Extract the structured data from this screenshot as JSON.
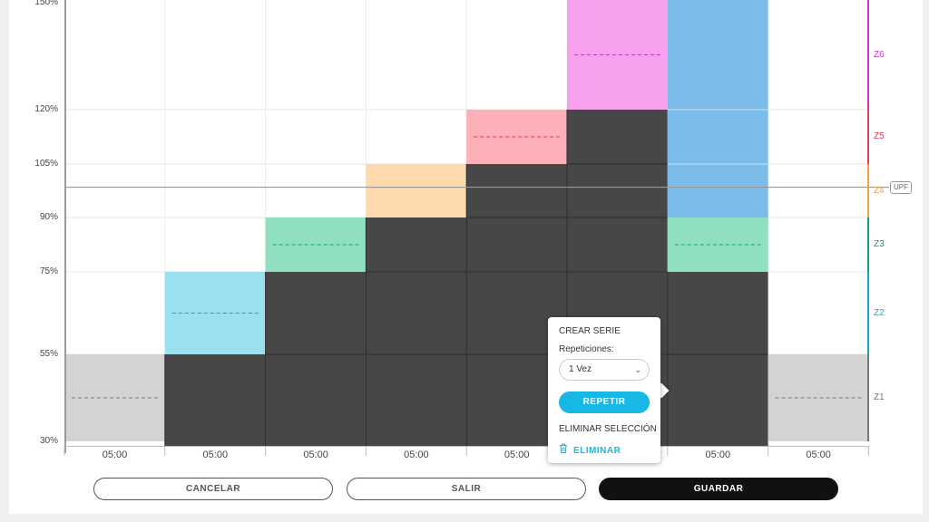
{
  "y_axis_labels": [
    "150%",
    "120%",
    "105%",
    "90%",
    "75%",
    "55%",
    "30%"
  ],
  "y_axis_values": [
    150,
    120,
    105,
    90,
    75,
    55,
    30
  ],
  "x_labels": [
    "05:00",
    "05:00",
    "05:00",
    "05:00",
    "05:00",
    "05:00",
    "05:00",
    "05:00"
  ],
  "zones": [
    {
      "name": "Z6",
      "color": "#cc33cc",
      "value": 135
    },
    {
      "name": "Z5",
      "color": "#e04050",
      "value": 112.5
    },
    {
      "name": "Z4",
      "color": "#f0a040",
      "value": 98.5
    },
    {
      "name": "Z3",
      "color": "#10a070",
      "value": 82.5
    },
    {
      "name": "Z2",
      "color": "#10a8d0",
      "value": 65
    },
    {
      "name": "Z1",
      "color": "#777777",
      "value": 42.5
    }
  ],
  "upf_label": "UPF",
  "upf_value": 98.5,
  "segments": [
    {
      "duration": "05:00",
      "zone": "Z1",
      "target": 42.5,
      "selected": false
    },
    {
      "duration": "05:00",
      "zone": "Z2",
      "target": 65,
      "selected": true
    },
    {
      "duration": "05:00",
      "zone": "Z3",
      "target": 82.5,
      "selected": true
    },
    {
      "duration": "05:00",
      "zone": "Z4",
      "target": 98.5,
      "selected": true
    },
    {
      "duration": "05:00",
      "zone": "Z5",
      "target": 112.5,
      "selected": true
    },
    {
      "duration": "05:00",
      "zone": "Z6",
      "target": 135,
      "selected": true
    },
    {
      "duration": "05:00",
      "zone": "Z3",
      "target": 82.5,
      "selected": true
    },
    {
      "duration": "05:00",
      "zone": "Z1",
      "target": 42.5,
      "selected": false
    }
  ],
  "zone_fill_colors": {
    "Z1": "#d3d3d3",
    "Z2": "#9ae0ee",
    "Z3": "#8ee0c0",
    "Z4": "#fdd9ad",
    "Z5": "#fdb0b8",
    "Z6": "#f7a0ee",
    "Z6_last": "#7bbde8"
  },
  "selected_color": "#474747",
  "popup": {
    "title": "CREAR SERIE",
    "repetitions_label": "Repeticiones:",
    "repetitions_value": "1 Vez",
    "repeat_button": "REPETIR",
    "delete_title": "ELIMINAR SELECCIÓN",
    "delete_button": "ELIMINAR"
  },
  "buttons": {
    "cancel": "CANCELAR",
    "exit": "SALIR",
    "save": "GUARDAR"
  }
}
